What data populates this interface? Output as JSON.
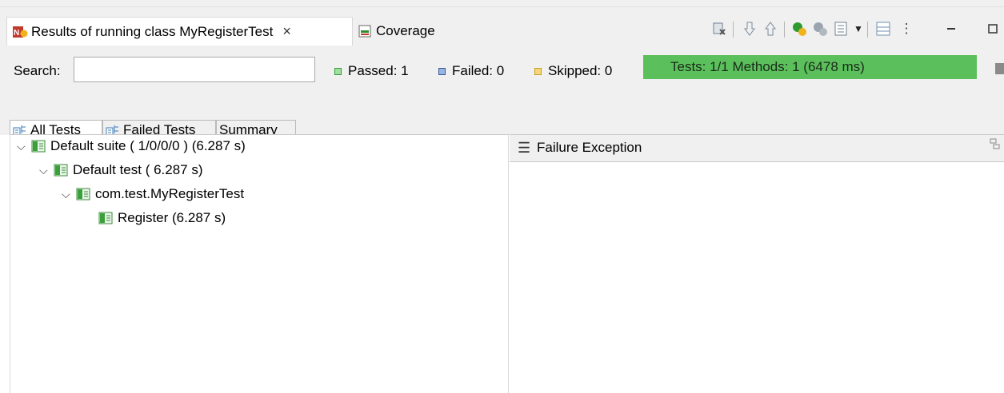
{
  "tabs": {
    "results_label": "Results of running class MyRegisterTest",
    "close_glyph": "×",
    "coverage_label": "Coverage"
  },
  "toolbar": {
    "icons": [
      "clear-icon",
      "next-failure-icon",
      "previous-failure-icon",
      "rerun-icon",
      "rerun-failed-icon",
      "history-icon",
      "dropdown-icon",
      "layout-icon",
      "view-menu-icon",
      "minimize-icon",
      "maximize-icon"
    ]
  },
  "search": {
    "label": "Search:",
    "value": "",
    "placeholder": ""
  },
  "stats": {
    "passed": "Passed: 1",
    "failed": "Failed: 0",
    "skipped": "Skipped: 0",
    "progress_text": "Tests: 1/1  Methods: 1 (6478 ms)",
    "progress_fraction": 1.0
  },
  "inner_tabs": {
    "all": "All Tests",
    "failed": "Failed Tests",
    "summary": "Summary"
  },
  "tree": [
    {
      "label": "Default suite ( 1/0/0/0 ) (6.287 s)",
      "level": 0,
      "expanded": true
    },
    {
      "label": "Default test ( 6.287 s)",
      "level": 1,
      "expanded": true
    },
    {
      "label": "com.test.MyRegisterTest",
      "level": 2,
      "expanded": true
    },
    {
      "label": "Register  (6.287 s)",
      "level": 3,
      "expanded": false
    }
  ],
  "detail": {
    "title": "Failure Exception"
  },
  "colors": {
    "progress_green": "#5bc05b",
    "passed": "#3a9a3a",
    "failed": "#3a5a9a",
    "skipped": "#c8a020"
  }
}
